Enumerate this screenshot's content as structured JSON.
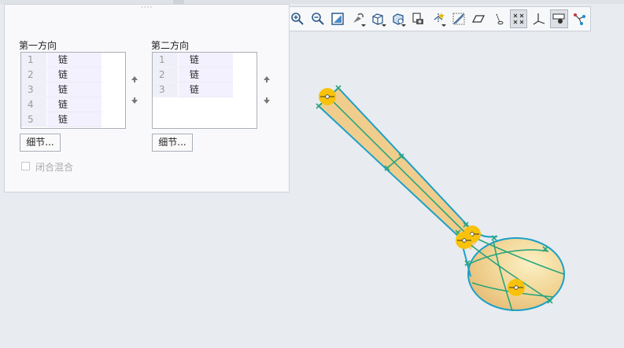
{
  "toolbar": {
    "icons": [
      "zoom-in-icon",
      "zoom-out-icon",
      "refit-icon",
      "repaint-icon",
      "display-style-icon",
      "saved-orientations-icon",
      "view-manager-icon",
      "datum-display-icon",
      "annotation-display-icon",
      "plane-display-icon",
      "axis-display-icon",
      "point-display-icon",
      "csys-display-icon",
      "spin-center-icon",
      "hidden-line-icon"
    ]
  },
  "blend_panel": {
    "first_direction": {
      "label": "第一方向",
      "rows": [
        {
          "index": "1",
          "value": "链"
        },
        {
          "index": "2",
          "value": "链"
        },
        {
          "index": "3",
          "value": "链"
        },
        {
          "index": "4",
          "value": "链"
        },
        {
          "index": "5",
          "value": "链"
        }
      ],
      "details_label": "细节..."
    },
    "second_direction": {
      "label": "第二方向",
      "rows": [
        {
          "index": "1",
          "value": "链"
        },
        {
          "index": "2",
          "value": "链"
        },
        {
          "index": "3",
          "value": "链"
        }
      ],
      "details_label": "细节..."
    },
    "closed_blend": {
      "label": "闭合混合",
      "checked": false
    }
  },
  "colors": {
    "surface": "#f0cd8c",
    "edge": "#1aa0c8",
    "curve": "#2aa57c",
    "handle": "#f8c20c",
    "background": "#e8ebef"
  }
}
